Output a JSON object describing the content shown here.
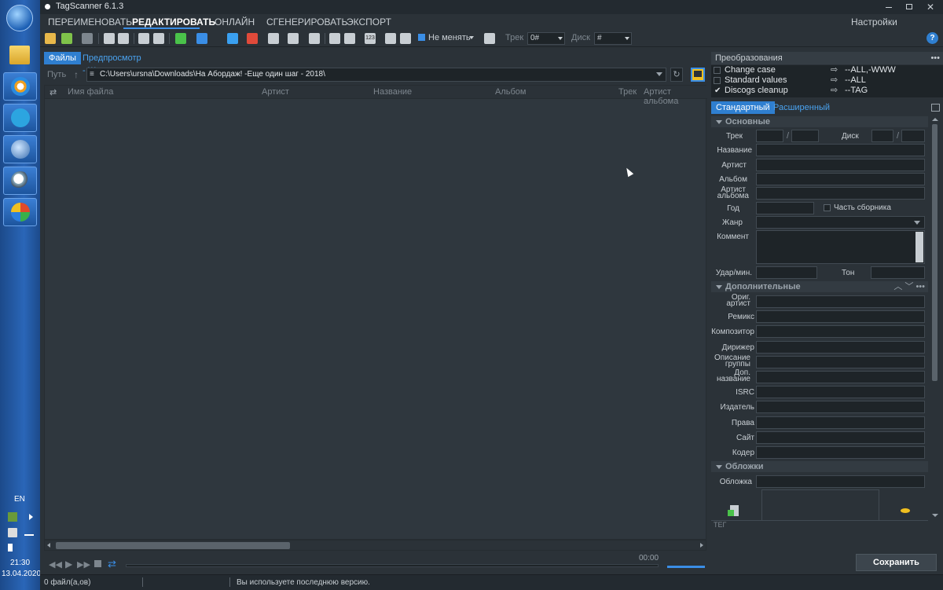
{
  "window": {
    "title": "TagScanner 6.1.3"
  },
  "menu": {
    "items": [
      "ПЕРЕИМЕНОВАТЬ",
      "РЕДАКТИРОВАТЬ",
      "ОНЛАЙН",
      "СГЕНЕРИРОВАТЬ",
      "ЭКСПОРТ"
    ],
    "settings": "Настройки программы"
  },
  "toolbar": {
    "case_select": "Не менять",
    "track_label": "Трек",
    "track_value": "0#",
    "disc_label": "Диск",
    "disc_value": "#"
  },
  "left_tabs": {
    "files": "Файлы",
    "preview": "Предпросмотр - Журнал"
  },
  "path": {
    "label": "Путь",
    "value": "C:\\Users\\ursna\\Downloads\\На Абордаж! -Еще один шаг - 2018\\"
  },
  "file_columns": [
    "Имя файла",
    "Артист",
    "Название",
    "Альбом",
    "Трек",
    "Артист альбома"
  ],
  "player": {
    "time": "00:00"
  },
  "transforms": {
    "title": "Преобразования",
    "items": [
      {
        "name": "Change case",
        "checked": false,
        "value": "--ALL,-WWW"
      },
      {
        "name": "Standard values",
        "checked": false,
        "value": "--ALL"
      },
      {
        "name": "Discogs cleanup",
        "checked": true,
        "value": "--TAG"
      }
    ]
  },
  "editor_tabs": {
    "standard": "Стандартный",
    "extended": "Расширенный"
  },
  "sections": {
    "basic": "Основные",
    "additional": "Дополнительные",
    "covers": "Обложки"
  },
  "basic_fields": {
    "track": "Трек",
    "disc": "Диск",
    "title": "Название",
    "artist": "Артист",
    "album": "Альбом",
    "album_artist_1": "Артист",
    "album_artist_2": "альбома",
    "year": "Год",
    "compilation": "Часть сборника",
    "genre": "Жанр",
    "comment": "Коммент",
    "bpm": "Удар/мин.",
    "key": "Тон"
  },
  "extra_fields": [
    {
      "l1": "Ориг.",
      "l2": "артист"
    },
    {
      "l1": "Ремикс",
      "l2": ""
    },
    {
      "l1": "Композитор",
      "l2": ""
    },
    {
      "l1": "Дирижер",
      "l2": ""
    },
    {
      "l1": "Описание",
      "l2": "группы"
    },
    {
      "l1": "Доп.",
      "l2": "название"
    },
    {
      "l1": "ISRC",
      "l2": ""
    },
    {
      "l1": "Издатель",
      "l2": ""
    },
    {
      "l1": "Права",
      "l2": ""
    },
    {
      "l1": "Сайт",
      "l2": ""
    },
    {
      "l1": "Кодер",
      "l2": ""
    }
  ],
  "cover": {
    "label": "Обложка",
    "tag_label": "ТЕГ"
  },
  "save_button": "Сохранить",
  "status": {
    "files": "0 файл(а,ов)",
    "message": "Вы используете последнюю версию."
  },
  "tray": {
    "lang": "EN",
    "time": "21:30",
    "date": "13.04.2020"
  }
}
